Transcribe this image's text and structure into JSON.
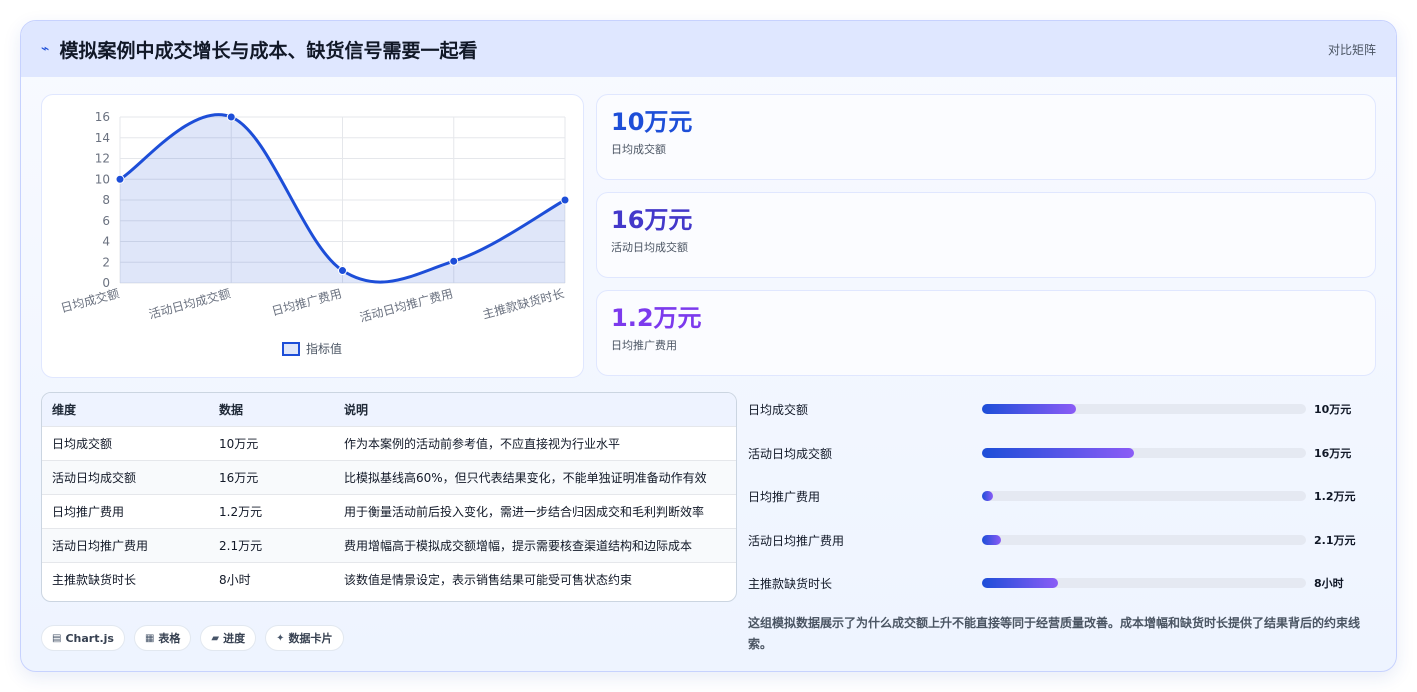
{
  "header": {
    "icon": "trend-line-icon",
    "title": "模拟案例中成交增长与成本、缺货信号需要一起看",
    "action_label": "对比矩阵"
  },
  "chart_data": {
    "type": "line",
    "categories": [
      "日均成交额",
      "活动日均成交额",
      "日均推广费用",
      "活动日均推广费用",
      "主推款缺货时长"
    ],
    "series": [
      {
        "name": "指标值",
        "values": [
          10,
          16,
          1.2,
          2.1,
          8
        ],
        "color": "#1d4ed8"
      }
    ],
    "ylim": [
      0,
      16
    ],
    "yticks": [
      0,
      2,
      4,
      6,
      8,
      10,
      12,
      14,
      16
    ],
    "grid": true,
    "legend": "bottom",
    "smooth": true,
    "filled": true
  },
  "kpis": [
    {
      "value": "10万元",
      "label": "日均成交额",
      "color": "#1d4ed8"
    },
    {
      "value": "16万元",
      "label": "活动日均成交额",
      "color": "#4338ca"
    },
    {
      "value": "1.2万元",
      "label": "日均推广费用",
      "color": "#7c3aed"
    }
  ],
  "table": {
    "headers": [
      "维度",
      "数据",
      "说明"
    ],
    "rows": [
      [
        "日均成交额",
        "10万元",
        "作为本案例的活动前参考值，不应直接视为行业水平"
      ],
      [
        "活动日均成交额",
        "16万元",
        "比模拟基线高60%，但只代表结果变化，不能单独证明准备动作有效"
      ],
      [
        "日均推广费用",
        "1.2万元",
        "用于衡量活动前后投入变化，需进一步结合归因成交和毛利判断效率"
      ],
      [
        "活动日均推广费用",
        "2.1万元",
        "费用增幅高于模拟成交额增幅，提示需要核查渠道结构和边际成本"
      ],
      [
        "主推款缺货时长",
        "8小时",
        "该数值是情景设定，表示销售结果可能受可售状态约束"
      ]
    ]
  },
  "bars": [
    {
      "label": "日均成交额",
      "value": "10万元",
      "fraction": 0.29
    },
    {
      "label": "活动日均成交额",
      "value": "16万元",
      "fraction": 0.47
    },
    {
      "label": "日均推广费用",
      "value": "1.2万元",
      "fraction": 0.035
    },
    {
      "label": "活动日均推广费用",
      "value": "2.1万元",
      "fraction": 0.06
    },
    {
      "label": "主推款缺货时长",
      "value": "8小时",
      "fraction": 0.235
    }
  ],
  "tags": [
    {
      "icon": "chart-icon",
      "glyph": "▤",
      "label": "Chart.js"
    },
    {
      "icon": "table-icon",
      "glyph": "▦",
      "label": "表格"
    },
    {
      "icon": "progress-icon",
      "glyph": "▰",
      "label": "进度"
    },
    {
      "icon": "sparkle-icon",
      "glyph": "✦",
      "label": "数据卡片"
    }
  ],
  "note": "这组模拟数据展示了为什么成交额上升不能直接等同于经营质量改善。成本增幅和缺货时长提供了结果背后的约束线索。"
}
